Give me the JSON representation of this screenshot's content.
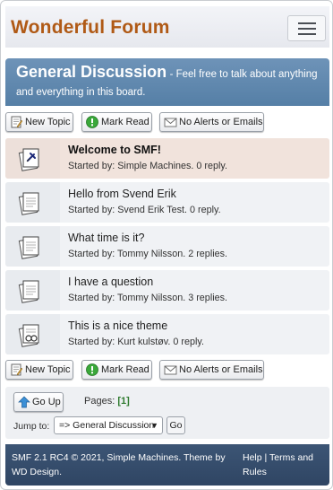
{
  "header": {
    "forum_title": "Wonderful Forum",
    "menu_icon": "hamburger-menu-icon"
  },
  "board": {
    "name": "General Discussion",
    "description": "- Feel free to talk about anything and everything in this board."
  },
  "buttons": {
    "new_topic": "New Topic",
    "mark_read": "Mark Read",
    "no_alerts": "No Alerts or Emails"
  },
  "topics": [
    {
      "subject": "Welcome to SMF!",
      "started": "Started by: Simple Machines. 0 reply.",
      "sticky": true,
      "icon": "pinned-post-icon"
    },
    {
      "subject": "Hello from Svend Erik",
      "started": "Started by: Svend Erik Test. 0 reply.",
      "sticky": false,
      "icon": "post-icon"
    },
    {
      "subject": "What time is it?",
      "started": "Started by: Tommy Nilsson. 2 replies.",
      "sticky": false,
      "icon": "post-icon"
    },
    {
      "subject": "I have a question",
      "started": "Started by: Tommy Nilsson. 3 replies.",
      "sticky": false,
      "icon": "post-icon"
    },
    {
      "subject": "This is a nice theme",
      "started": "Started by: Kurt kulstøv. 0 reply.",
      "sticky": false,
      "icon": "post-poll-icon"
    }
  ],
  "pagination": {
    "go_up": "Go Up",
    "pages_label": "Pages:",
    "current_page": "[1]"
  },
  "jump": {
    "label": "Jump to:",
    "selected": "=> General Discussion",
    "go": "Go"
  },
  "footer": {
    "copyright": "SMF 2.1 RC4 © 2021, Simple Machines. Theme by WD Design.",
    "help": "Help",
    "separator": "|",
    "terms": "Terms and Rules"
  },
  "colors": {
    "title": "#b05a16",
    "banner": "#5f86ad",
    "sticky_row": "#f1e3dc",
    "footer": "#34496a"
  }
}
